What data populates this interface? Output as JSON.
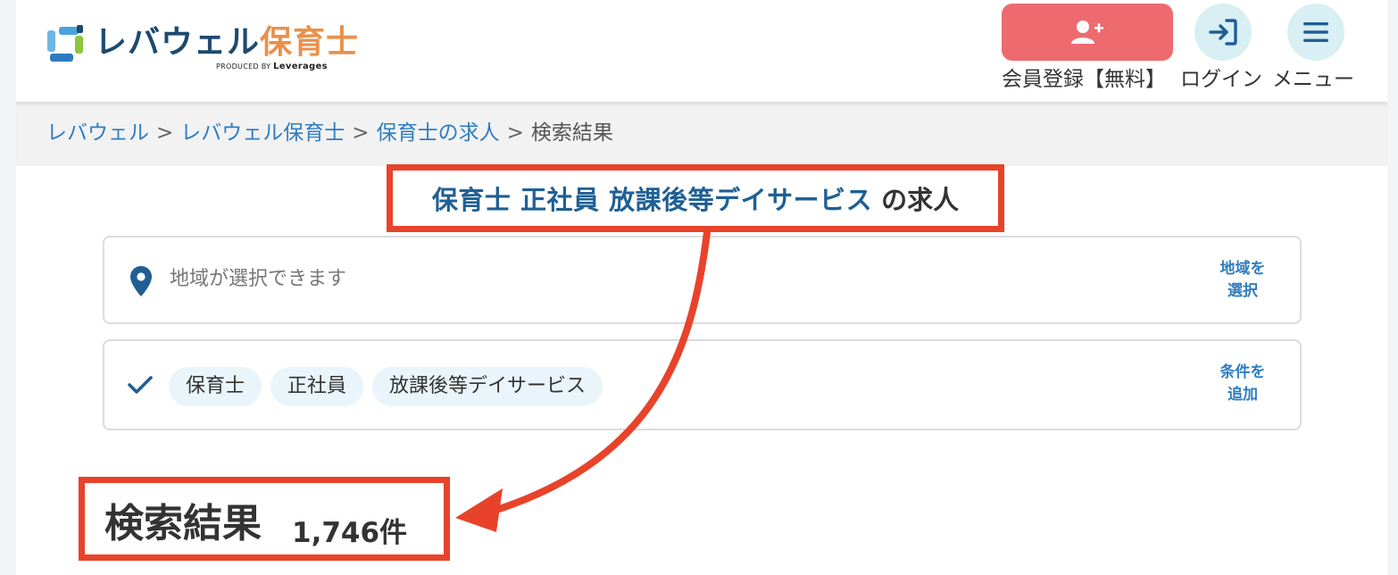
{
  "header": {
    "logo_main": "レバウェル",
    "logo_accent": "保育士",
    "logo_sub_prefix": "PRODUCED BY ",
    "logo_sub_brand": "Leverages",
    "register_label": "会員登録【無料】",
    "login_label": "ログイン",
    "menu_label": "メニュー",
    "register_icon": "user-plus-icon",
    "login_icon": "login-arrow-icon",
    "menu_icon": "hamburger-icon"
  },
  "breadcrumb": {
    "items": [
      "レバウェル",
      "レバウェル保育士",
      "保育士の求人"
    ],
    "separator": ">",
    "current": "検索結果"
  },
  "search": {
    "heading_keywords": "保育士 正社員 放課後等デイサービス",
    "heading_suffix": "の求人",
    "area_placeholder": "地域が選択できます",
    "area_link_line1": "地域を",
    "area_link_line2": "選択",
    "conditions": [
      "保育士",
      "正社員",
      "放課後等デイサービス"
    ],
    "cond_link_line1": "条件を",
    "cond_link_line2": "追加"
  },
  "results": {
    "title": "検索結果",
    "count": "1,746件"
  },
  "colors": {
    "annotation": "#e8432a",
    "link": "#2f7dc1",
    "register_button": "#ed6a6e",
    "round_button": "#d8eff3",
    "heading_blue": "#1f5f94",
    "logo_accent": "#e8914c"
  }
}
